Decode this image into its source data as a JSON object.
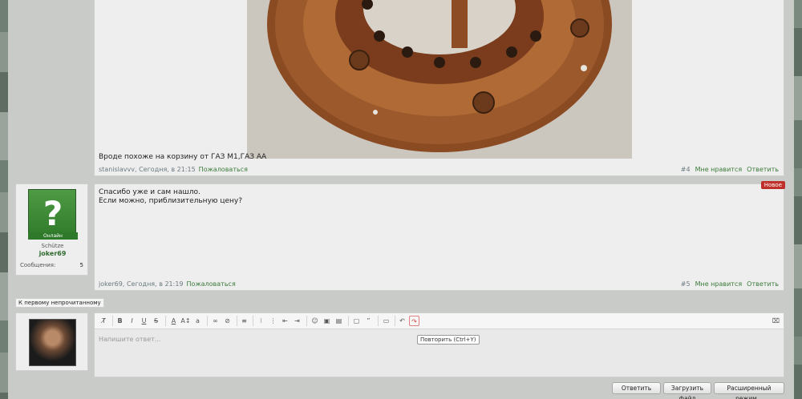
{
  "post4": {
    "message": "Вроде похоже на корзину от ГАЗ М1,ГАЗ АА",
    "author_time": "stanislavvv, Сегодня, в 21:15",
    "report": "Пожаловаться",
    "number": "#4",
    "like": "Мне нравится",
    "reply": "Ответить"
  },
  "post5": {
    "new_badge": "Новое",
    "line1": "Спасибо уже и сам нашло.",
    "line2": "Если можно, приблизительную цену?",
    "author_time": "joker69, Сегодня, в 21:19",
    "report": "Пожаловаться",
    "number": "#5",
    "like": "Мне нравится",
    "reply": "Ответить",
    "user": {
      "online": "Онлайн",
      "title": "Schütze",
      "name": "joker69",
      "messages_label": "Сообщения:",
      "messages_value": "5"
    }
  },
  "nav": {
    "first_unread": "К первому непрочитанному"
  },
  "editor": {
    "placeholder": "Напишите ответ...",
    "tooltip": "Повторить (Ctrl+Y)",
    "toolbar_icons": [
      "remove-format-icon",
      "bold-icon",
      "italic-icon",
      "underline-icon",
      "strike-icon",
      "text-color-icon",
      "font-size-icon",
      "font-family-icon",
      "link-icon",
      "unlink-icon",
      "align-icon",
      "bullet-list-icon",
      "number-list-icon",
      "outdent-icon",
      "indent-icon",
      "smilie-icon",
      "image-icon",
      "media-icon",
      "code-icon",
      "quote-icon",
      "save-draft-icon",
      "undo-icon",
      "redo-icon",
      "toggle-source-icon"
    ]
  },
  "buttons": {
    "reply": "Ответить",
    "upload": "Загрузить файл",
    "advanced": "Расширенный режим..."
  }
}
